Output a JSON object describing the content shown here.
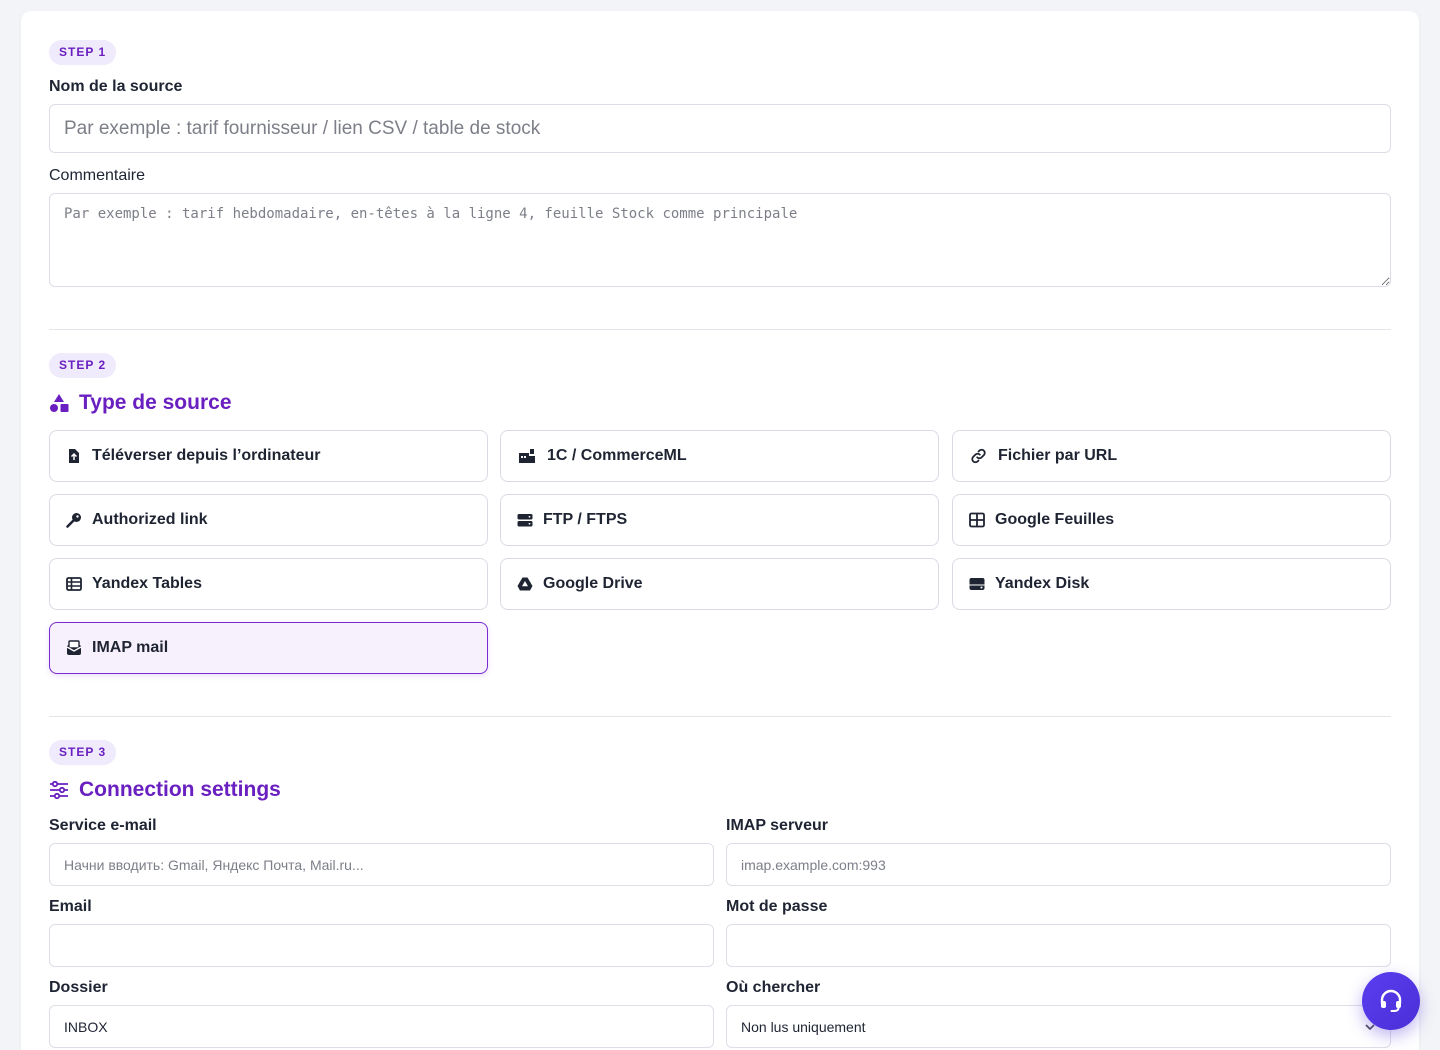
{
  "step1": {
    "badge": "STEP 1",
    "source_name_label": "Nom de la source",
    "source_name_placeholder": "Par exemple : tarif fournisseur / lien CSV / table de stock",
    "comment_label": "Commentaire",
    "comment_placeholder": "Par exemple : tarif hebdomadaire, en-têtes à la ligne 4, feuille Stock comme principale"
  },
  "step2": {
    "badge": "STEP 2",
    "title": "Type de source",
    "options": [
      {
        "label": "Téléverser depuis l’ordinateur",
        "icon": "file-upload-icon"
      },
      {
        "label": "1C / CommerceML",
        "icon": "warehouse-icon"
      },
      {
        "label": "Fichier par URL",
        "icon": "link-icon"
      },
      {
        "label": "Authorized link",
        "icon": "key-icon"
      },
      {
        "label": "FTP / FTPS",
        "icon": "server-icon"
      },
      {
        "label": "Google Feuilles",
        "icon": "table-icon"
      },
      {
        "label": "Yandex Tables",
        "icon": "list-table-icon"
      },
      {
        "label": "Google Drive",
        "icon": "google-drive-icon"
      },
      {
        "label": "Yandex Disk",
        "icon": "hard-drive-icon"
      },
      {
        "label": "IMAP mail",
        "icon": "mail-inbox-icon",
        "selected": true
      }
    ]
  },
  "step3": {
    "badge": "STEP 3",
    "title": "Connection settings",
    "email_service_label": "Service e-mail",
    "email_service_placeholder": "Начни вводить: Gmail, Яндекс Почта, Mail.ru...",
    "imap_server_label": "IMAP serveur",
    "imap_server_placeholder": "imap.example.com:993",
    "email_label": "Email",
    "email_value": "",
    "password_label": "Mot de passe",
    "password_value": "",
    "folder_label": "Dossier",
    "folder_value": "INBOX",
    "search_label": "Où chercher",
    "search_value": "Non lus uniquement"
  },
  "colors": {
    "accent": "#6a1fc0",
    "badge_bg": "#efeafc",
    "fab": "#4a2fd6"
  }
}
